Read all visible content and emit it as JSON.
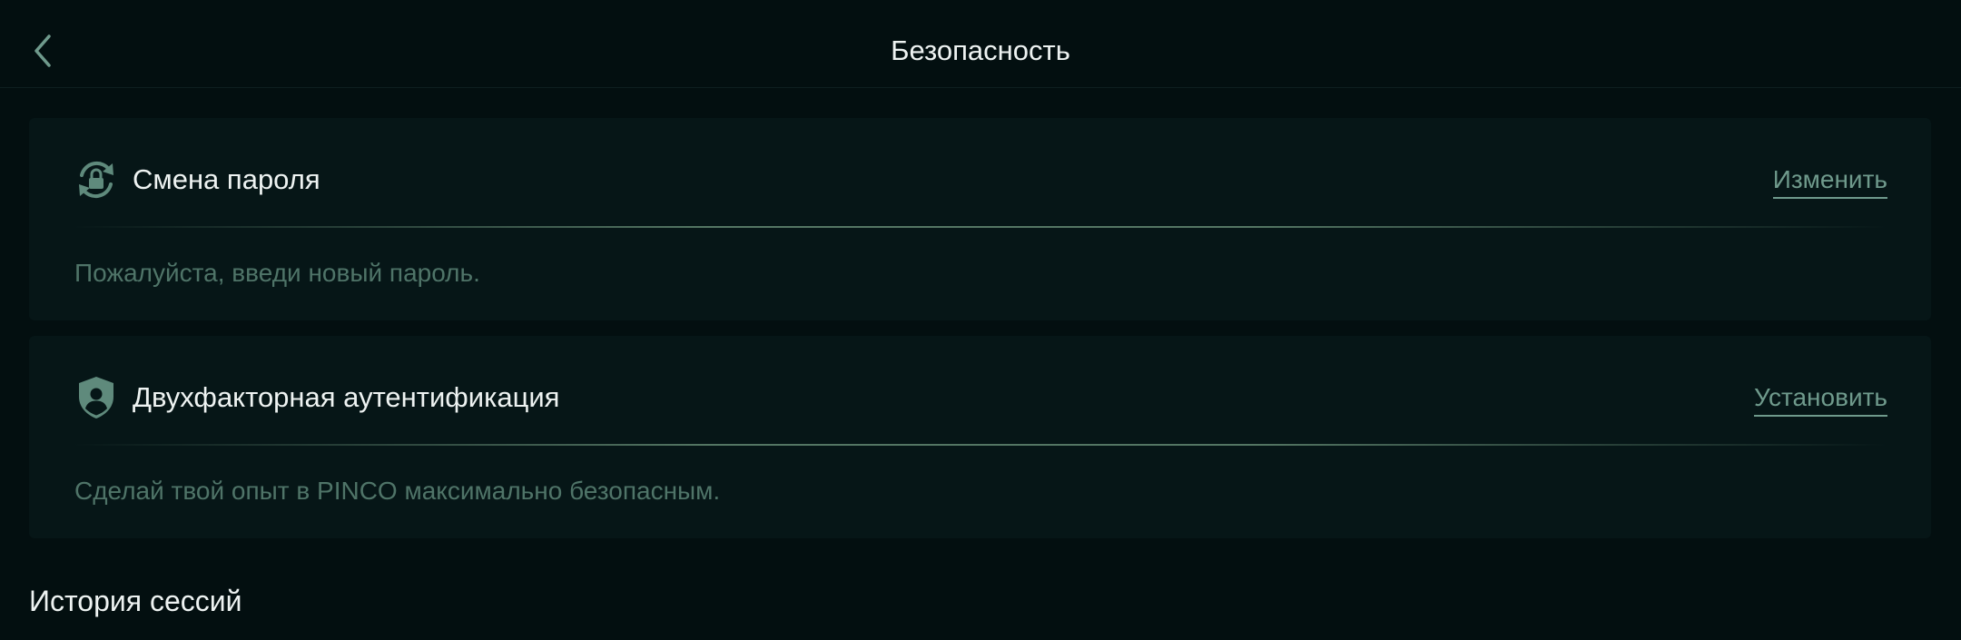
{
  "header": {
    "title": "Безопасность",
    "back_icon": "chevron-left-icon"
  },
  "cards": [
    {
      "icon": "lock-refresh-icon",
      "title": "Смена пароля",
      "action_label": "Изменить",
      "description": "Пожалуйста, введи новый пароль."
    },
    {
      "icon": "shield-user-icon",
      "title": "Двухфакторная аутентификация",
      "action_label": "Установить",
      "description": "Сделай твой опыт в PINCO максимально безопасным."
    }
  ],
  "sessions": {
    "title": "История сессий"
  },
  "colors": {
    "background": "#030f10",
    "card": "#061617",
    "accent": "#6f9a8c",
    "muted_text": "#4f7468",
    "text": "#eef3f2"
  }
}
